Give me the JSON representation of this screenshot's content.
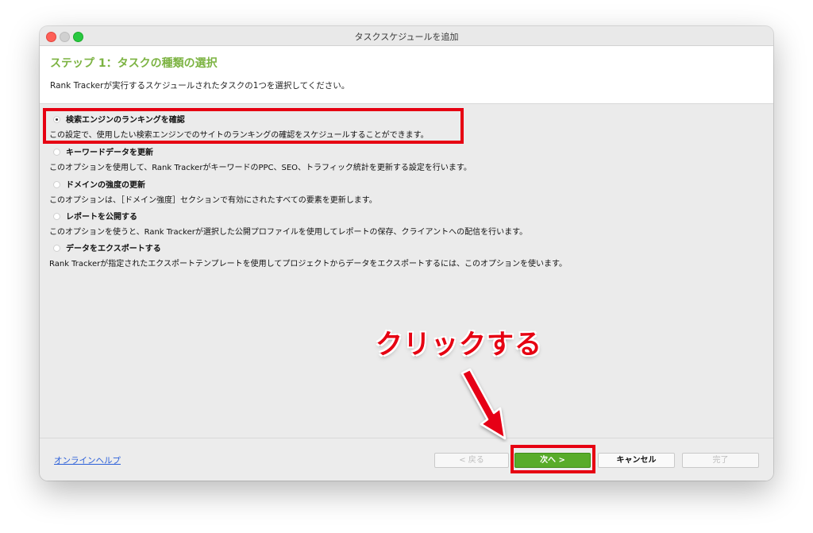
{
  "window": {
    "title": "タスクスケジュールを追加"
  },
  "header": {
    "step_title": "ステップ 1：タスクの種類の選択",
    "description": "Rank Trackerが実行するスケジュールされたタスクの1つを選択してください。"
  },
  "options": [
    {
      "label": "検索エンジンのランキングを確認",
      "description": "この設定で、使用したい検索エンジンでのサイトのランキングの確認をスケジュールすることができます。",
      "selected": true
    },
    {
      "label": "キーワードデータを更新",
      "description": "このオプションを使用して、Rank TrackerがキーワードのPPC、SEO、トラフィック統計を更新する設定を行います。",
      "selected": false
    },
    {
      "label": "ドメインの強度の更新",
      "description": "このオプションは、［ドメイン強度］セクションで有効にされたすべての要素を更新します。",
      "selected": false
    },
    {
      "label": "レポートを公開する",
      "description": "このオプションを使うと、Rank Trackerが選択した公開プロファイルを使用してレポートの保存、クライアントへの配信を行います。",
      "selected": false
    },
    {
      "label": "データをエクスポートする",
      "description": "Rank Trackerが指定されたエクスポートテンプレートを使用してプロジェクトからデータをエクスポートするには、このオプションを使います。",
      "selected": false
    }
  ],
  "footer": {
    "help_link": "オンラインヘルプ",
    "back_label": "< 戻る",
    "next_label": "次へ >",
    "cancel_label": "キャンセル",
    "finish_label": "完了"
  },
  "annotation": {
    "text": "クリックする",
    "color": "#e60012"
  },
  "colors": {
    "accent_green": "#7cb342",
    "next_button": "#58ac2a",
    "highlight_red": "#e60012"
  }
}
